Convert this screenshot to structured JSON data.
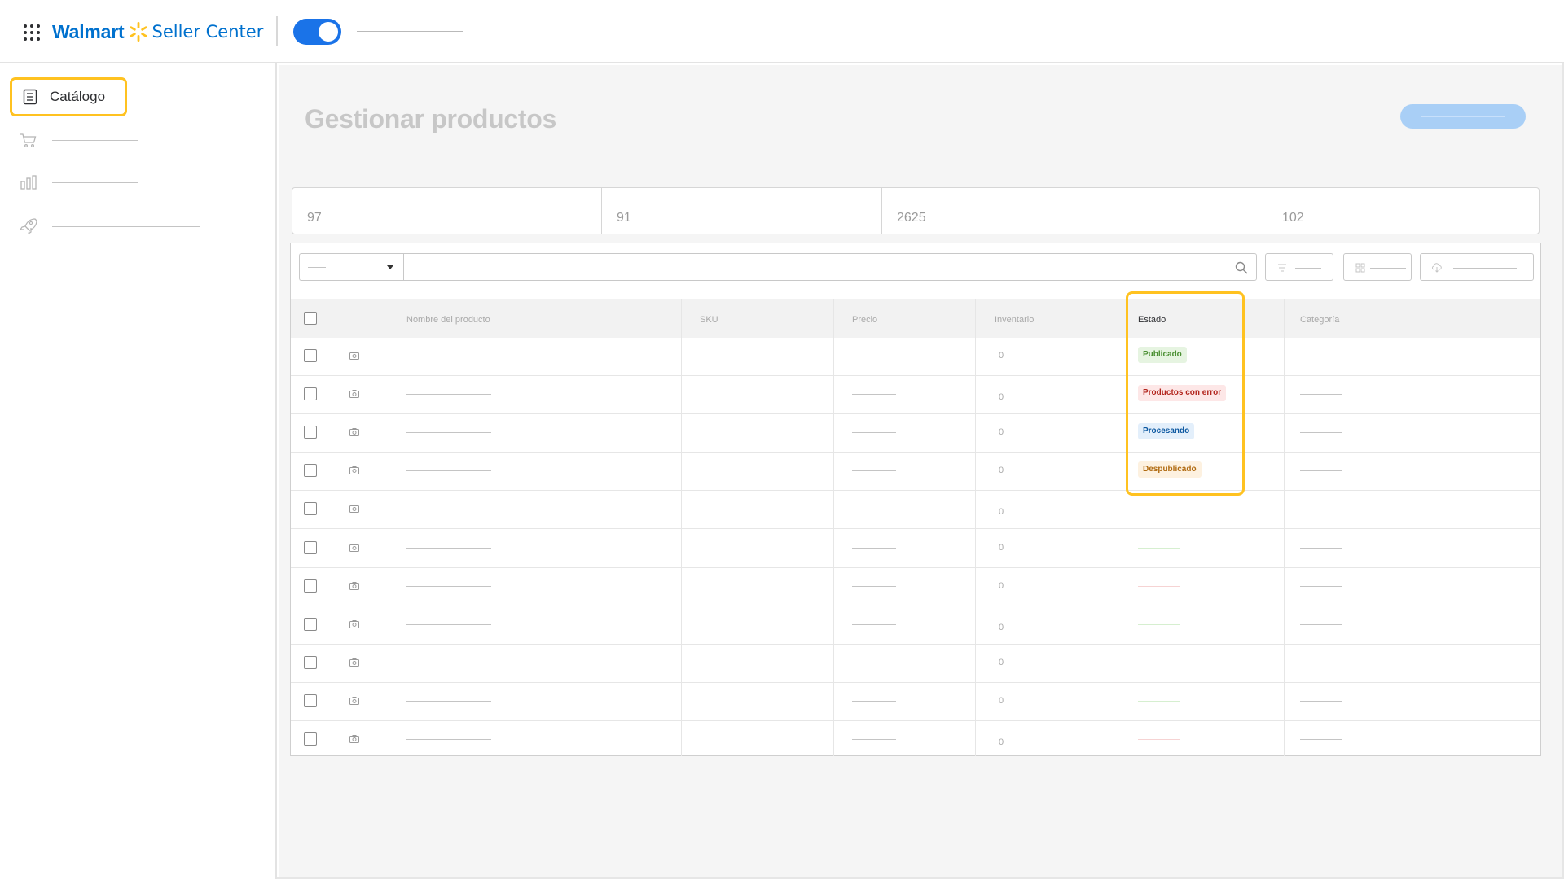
{
  "header": {
    "brand_name": "Walmart",
    "product_name": "Seller Center",
    "colors": {
      "brand_blue": "#0071ce",
      "spark_yellow": "#ffc220",
      "toggle_blue": "#1a73e8"
    },
    "toggle_state": "on"
  },
  "sidebar": {
    "items": [
      {
        "label": "Catálogo",
        "icon": "document-list-icon",
        "active": true
      },
      {
        "label": "",
        "icon": "cart-icon"
      },
      {
        "label": "",
        "icon": "bar-chart-icon"
      },
      {
        "label": "",
        "icon": "rocket-icon"
      }
    ]
  },
  "main": {
    "page_title": "Gestionar productos",
    "stats": [
      {
        "value": "97"
      },
      {
        "value": "91"
      },
      {
        "value": "2625"
      },
      {
        "value": "102"
      }
    ],
    "table": {
      "columns": [
        "Nombre del producto",
        "SKU",
        "Precio",
        "Inventario",
        "Estado",
        "Categoría"
      ],
      "rows": [
        {
          "inventario": "0",
          "estado": "Publicado"
        },
        {
          "inventario": "0",
          "estado": "Productos con error"
        },
        {
          "inventario": "0",
          "estado": "Procesando"
        },
        {
          "inventario": "0",
          "estado": "Despublicado"
        },
        {
          "inventario": "0",
          "estado": ""
        },
        {
          "inventario": "0",
          "estado": ""
        },
        {
          "inventario": "0",
          "estado": ""
        },
        {
          "inventario": "0",
          "estado": ""
        },
        {
          "inventario": "0",
          "estado": ""
        },
        {
          "inventario": "0",
          "estado": ""
        },
        {
          "inventario": "0",
          "estado": ""
        }
      ]
    },
    "status_colors": {
      "Publicado": {
        "bg": "#e6f4e1",
        "fg": "#4a8f32"
      },
      "Productos con error": {
        "bg": "#fde7e7",
        "fg": "#b3261e"
      },
      "Procesando": {
        "bg": "#e3effb",
        "fg": "#0b57a0"
      },
      "Despublicado": {
        "bg": "#fdf1e0",
        "fg": "#b06a10"
      }
    },
    "highlight_color": "#ffc220"
  }
}
